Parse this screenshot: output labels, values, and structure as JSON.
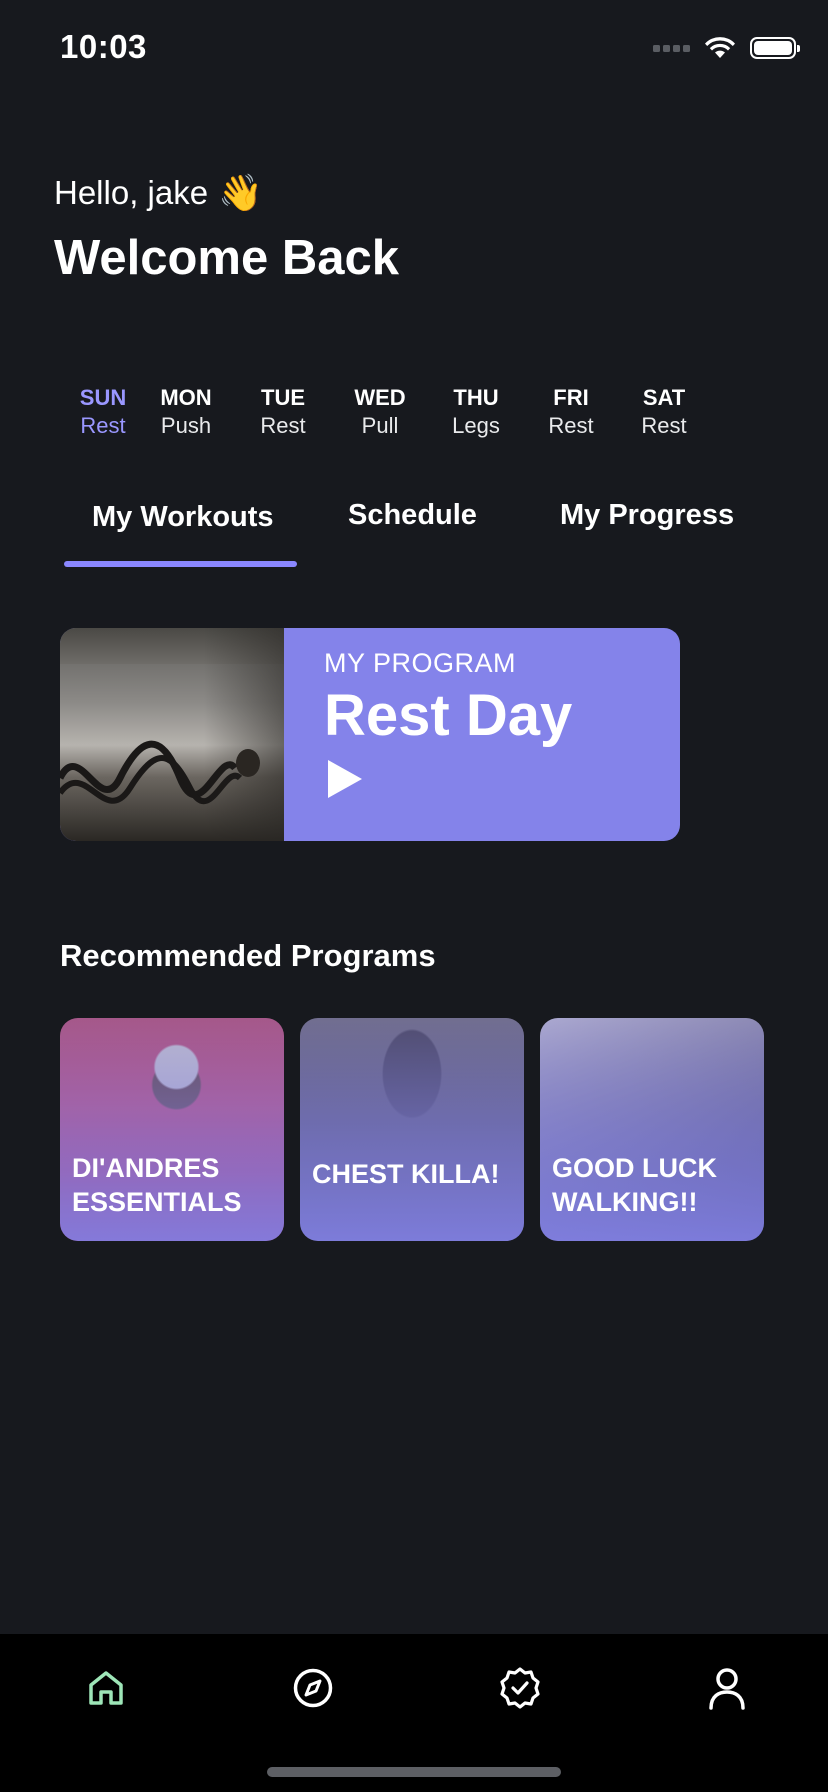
{
  "status_bar": {
    "time": "10:03"
  },
  "header": {
    "greeting": "Hello, jake",
    "greeting_emoji": "👋",
    "title": "Welcome Back"
  },
  "week": [
    {
      "day": "SUN",
      "workout": "Rest",
      "active": true
    },
    {
      "day": "MON",
      "workout": "Push",
      "active": false
    },
    {
      "day": "TUE",
      "workout": "Rest",
      "active": false
    },
    {
      "day": "WED",
      "workout": "Pull",
      "active": false
    },
    {
      "day": "THU",
      "workout": "Legs",
      "active": false
    },
    {
      "day": "FRI",
      "workout": "Rest",
      "active": false
    },
    {
      "day": "SAT",
      "workout": "Rest",
      "active": false
    }
  ],
  "tabs": [
    {
      "label": "My Workouts",
      "active": true
    },
    {
      "label": "Schedule",
      "active": false
    },
    {
      "label": "My Progress",
      "active": false
    }
  ],
  "program": {
    "label": "MY PROGRAM",
    "title": "Rest Day"
  },
  "recommended": {
    "title": "Recommended Programs",
    "items": [
      {
        "label": "DI'ANDRES ESSENTIALS"
      },
      {
        "label": "CHEST KILLA!"
      },
      {
        "label": "GOOD LUCK WALKING!!"
      }
    ]
  },
  "nav": [
    {
      "icon": "home-icon",
      "active": true
    },
    {
      "icon": "compass-icon",
      "active": false
    },
    {
      "icon": "badge-check-icon",
      "active": false
    },
    {
      "icon": "user-icon",
      "active": false
    }
  ],
  "colors": {
    "background": "#17191e",
    "accent": "#8483ea",
    "active_day": "#9a97ff",
    "nav_active": "#9ee6b8"
  }
}
